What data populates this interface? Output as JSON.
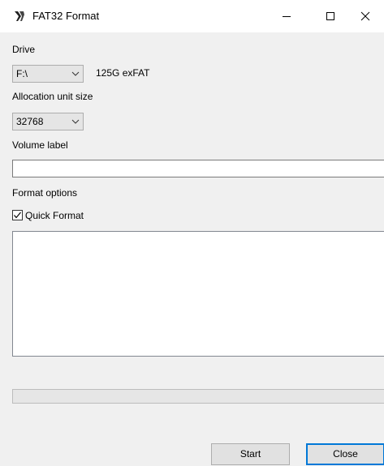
{
  "window": {
    "title": "FAT32 Format",
    "icon": "fat32-app-icon"
  },
  "drive": {
    "label": "Drive",
    "value": "F:\\",
    "info": "125G exFAT"
  },
  "allocation": {
    "label": "Allocation unit size",
    "value": "32768"
  },
  "volume": {
    "label": "Volume label",
    "value": ""
  },
  "format_options": {
    "label": "Format options",
    "quick_format_label": "Quick Format",
    "quick_format_checked": true
  },
  "log": {
    "text": ""
  },
  "progress": {
    "percent": 0
  },
  "buttons": {
    "start": "Start",
    "close": "Close"
  },
  "colors": {
    "focus_accent": "#0078d7",
    "background": "#f0f0f0"
  }
}
